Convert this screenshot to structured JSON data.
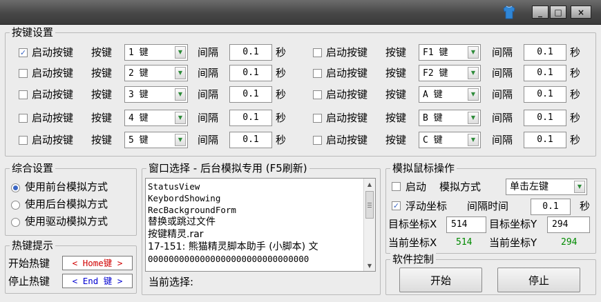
{
  "window": {
    "buttons": [
      "_",
      "□",
      "×"
    ]
  },
  "key_settings": {
    "legend": "按键设置",
    "rows": [
      {
        "enable_label": "启动按键",
        "enabled": true,
        "key_label": "按键",
        "key": "1 键",
        "interval_label": "间隔",
        "interval": "0.1",
        "unit": "秒"
      },
      {
        "enable_label": "启动按键",
        "enabled": false,
        "key_label": "按键",
        "key": "2 键",
        "interval_label": "间隔",
        "interval": "0.1",
        "unit": "秒"
      },
      {
        "enable_label": "启动按键",
        "enabled": false,
        "key_label": "按键",
        "key": "3 键",
        "interval_label": "间隔",
        "interval": "0.1",
        "unit": "秒"
      },
      {
        "enable_label": "启动按键",
        "enabled": false,
        "key_label": "按键",
        "key": "4 键",
        "interval_label": "间隔",
        "interval": "0.1",
        "unit": "秒"
      },
      {
        "enable_label": "启动按键",
        "enabled": false,
        "key_label": "按键",
        "key": "5 键",
        "interval_label": "间隔",
        "interval": "0.1",
        "unit": "秒"
      },
      {
        "enable_label": "启动按键",
        "enabled": false,
        "key_label": "按键",
        "key": "F1 键",
        "interval_label": "间隔",
        "interval": "0.1",
        "unit": "秒"
      },
      {
        "enable_label": "启动按键",
        "enabled": false,
        "key_label": "按键",
        "key": "F2 键",
        "interval_label": "间隔",
        "interval": "0.1",
        "unit": "秒"
      },
      {
        "enable_label": "启动按键",
        "enabled": false,
        "key_label": "按键",
        "key": "A 键",
        "interval_label": "间隔",
        "interval": "0.1",
        "unit": "秒"
      },
      {
        "enable_label": "启动按键",
        "enabled": false,
        "key_label": "按键",
        "key": "B 键",
        "interval_label": "间隔",
        "interval": "0.1",
        "unit": "秒"
      },
      {
        "enable_label": "启动按键",
        "enabled": false,
        "key_label": "按键",
        "key": "C 键",
        "interval_label": "间隔",
        "interval": "0.1",
        "unit": "秒"
      }
    ]
  },
  "general": {
    "legend": "综合设置",
    "options": [
      {
        "label": "使用前台模拟方式",
        "selected": true
      },
      {
        "label": "使用后台模拟方式",
        "selected": false
      },
      {
        "label": "使用驱动模拟方式",
        "selected": false
      }
    ]
  },
  "hotkeys": {
    "legend": "热键提示",
    "start_label": "开始热键",
    "start_value": "< Home键 >",
    "stop_label": "停止热键",
    "stop_value": "< End 键 >"
  },
  "window_select": {
    "legend": "窗口选择 - 后台模拟专用 (F5刷新)",
    "items": [
      "StatusView",
      "KeybordShowing",
      "RecBackgroundForm",
      "替换或跳过文件",
      "按键精灵.rar",
      "17-151: 熊猫精灵脚本助手 (小脚本) 文",
      "0000000000000000000000000000000"
    ],
    "current_label": "当前选择:"
  },
  "mouse": {
    "legend": "模拟鼠标操作",
    "start_label": "启动",
    "start_checked": false,
    "mode_label": "模拟方式",
    "mode_value": "单击左键",
    "float_label": "浮动坐标",
    "float_checked": true,
    "interval_label": "间隔时间",
    "interval_value": "0.1",
    "interval_unit": "秒",
    "target_x_label": "目标坐标X",
    "target_x": "514",
    "target_y_label": "目标坐标Y",
    "target_y": "294",
    "current_x_label": "当前坐标X",
    "current_x": "514",
    "current_y_label": "当前坐标Y",
    "current_y": "294"
  },
  "control": {
    "legend": "软件控制",
    "start_button": "开始",
    "stop_button": "停止"
  }
}
